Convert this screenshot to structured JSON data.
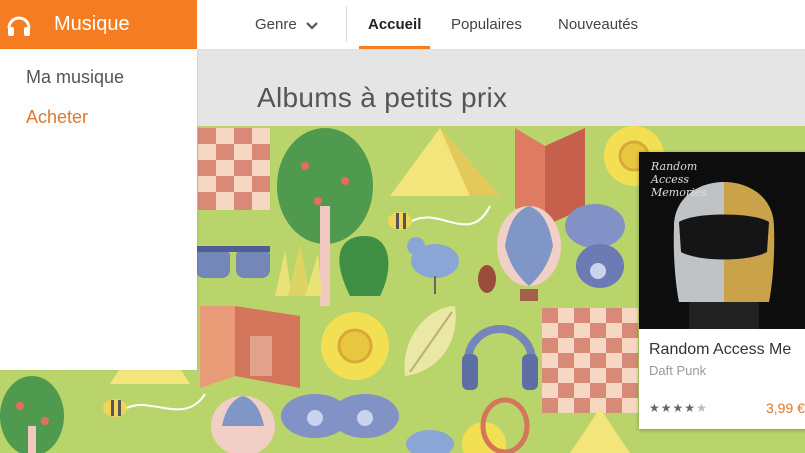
{
  "app": {
    "title": "Musique",
    "logo_icon": "headphones-icon",
    "accent": "#f57c20"
  },
  "nav": {
    "genre_label": "Genre",
    "tabs": [
      {
        "label": "Accueil",
        "active": true
      },
      {
        "label": "Populaires",
        "active": false
      },
      {
        "label": "Nouveautés",
        "active": false
      }
    ]
  },
  "sidebar": {
    "items": [
      {
        "label": "Ma musique",
        "active": false
      },
      {
        "label": "Acheter",
        "active": true
      }
    ]
  },
  "main": {
    "section_title": "Albums à petits prix",
    "albums": [
      {
        "title": "Random Access Memories",
        "title_visible": "Random Access Me",
        "artist": "Daft Punk",
        "price": "3,99 €",
        "rating": 4.5,
        "cover_text": "Random Access Memories"
      }
    ]
  }
}
